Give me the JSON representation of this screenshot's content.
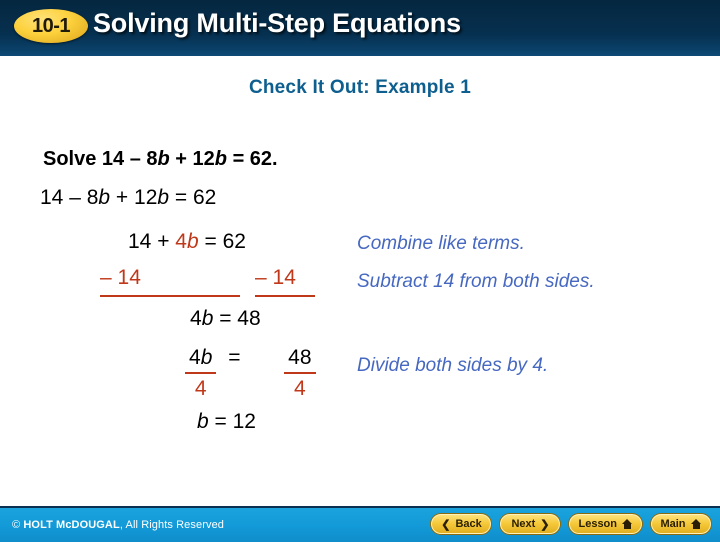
{
  "header": {
    "lesson_number": "10-1",
    "title": "Solving Multi-Step Equations"
  },
  "slide": {
    "subtitle": "Check It Out: Example 1",
    "prompt": {
      "label": "Solve ",
      "expr_a": "14 – 8",
      "var_a": "b",
      "expr_b": " + 12",
      "var_b": "b",
      "expr_c": " = 62."
    },
    "steps": {
      "step1": {
        "expr_a": "14 – 8",
        "var_a": "b",
        "expr_b": " + 12",
        "var_b": "b",
        "expr_c": " =  62"
      },
      "step2": {
        "expr_a": "14 + ",
        "coef": "4",
        "var_a": "b",
        "expr_b": " =  62"
      },
      "step3": {
        "left": "– 14",
        "right": "– 14"
      },
      "step4": {
        "coef": "4",
        "var_a": "b",
        "expr_b": " =  48"
      },
      "step5": {
        "left_num_coef": "4",
        "left_num_var": "b",
        "left_den": "4",
        "equals": "=",
        "right_num": "48",
        "right_den": "4"
      },
      "step6": {
        "var_a": "b",
        "expr_b": "  =   12"
      }
    },
    "notes": {
      "note1": "Combine like terms.",
      "note2": "Subtract 14 from both sides.",
      "note3": "Divide both sides by 4."
    }
  },
  "footer": {
    "copyright_mark": "© ",
    "copyright_brand": "HOLT McDOUGAL",
    "copyright_rest": ", All Rights Reserved",
    "buttons": {
      "back": "Back",
      "next": "Next",
      "lesson": "Lesson",
      "main": "Main"
    },
    "chevron_left": "❮",
    "chevron_right": "❯"
  }
}
